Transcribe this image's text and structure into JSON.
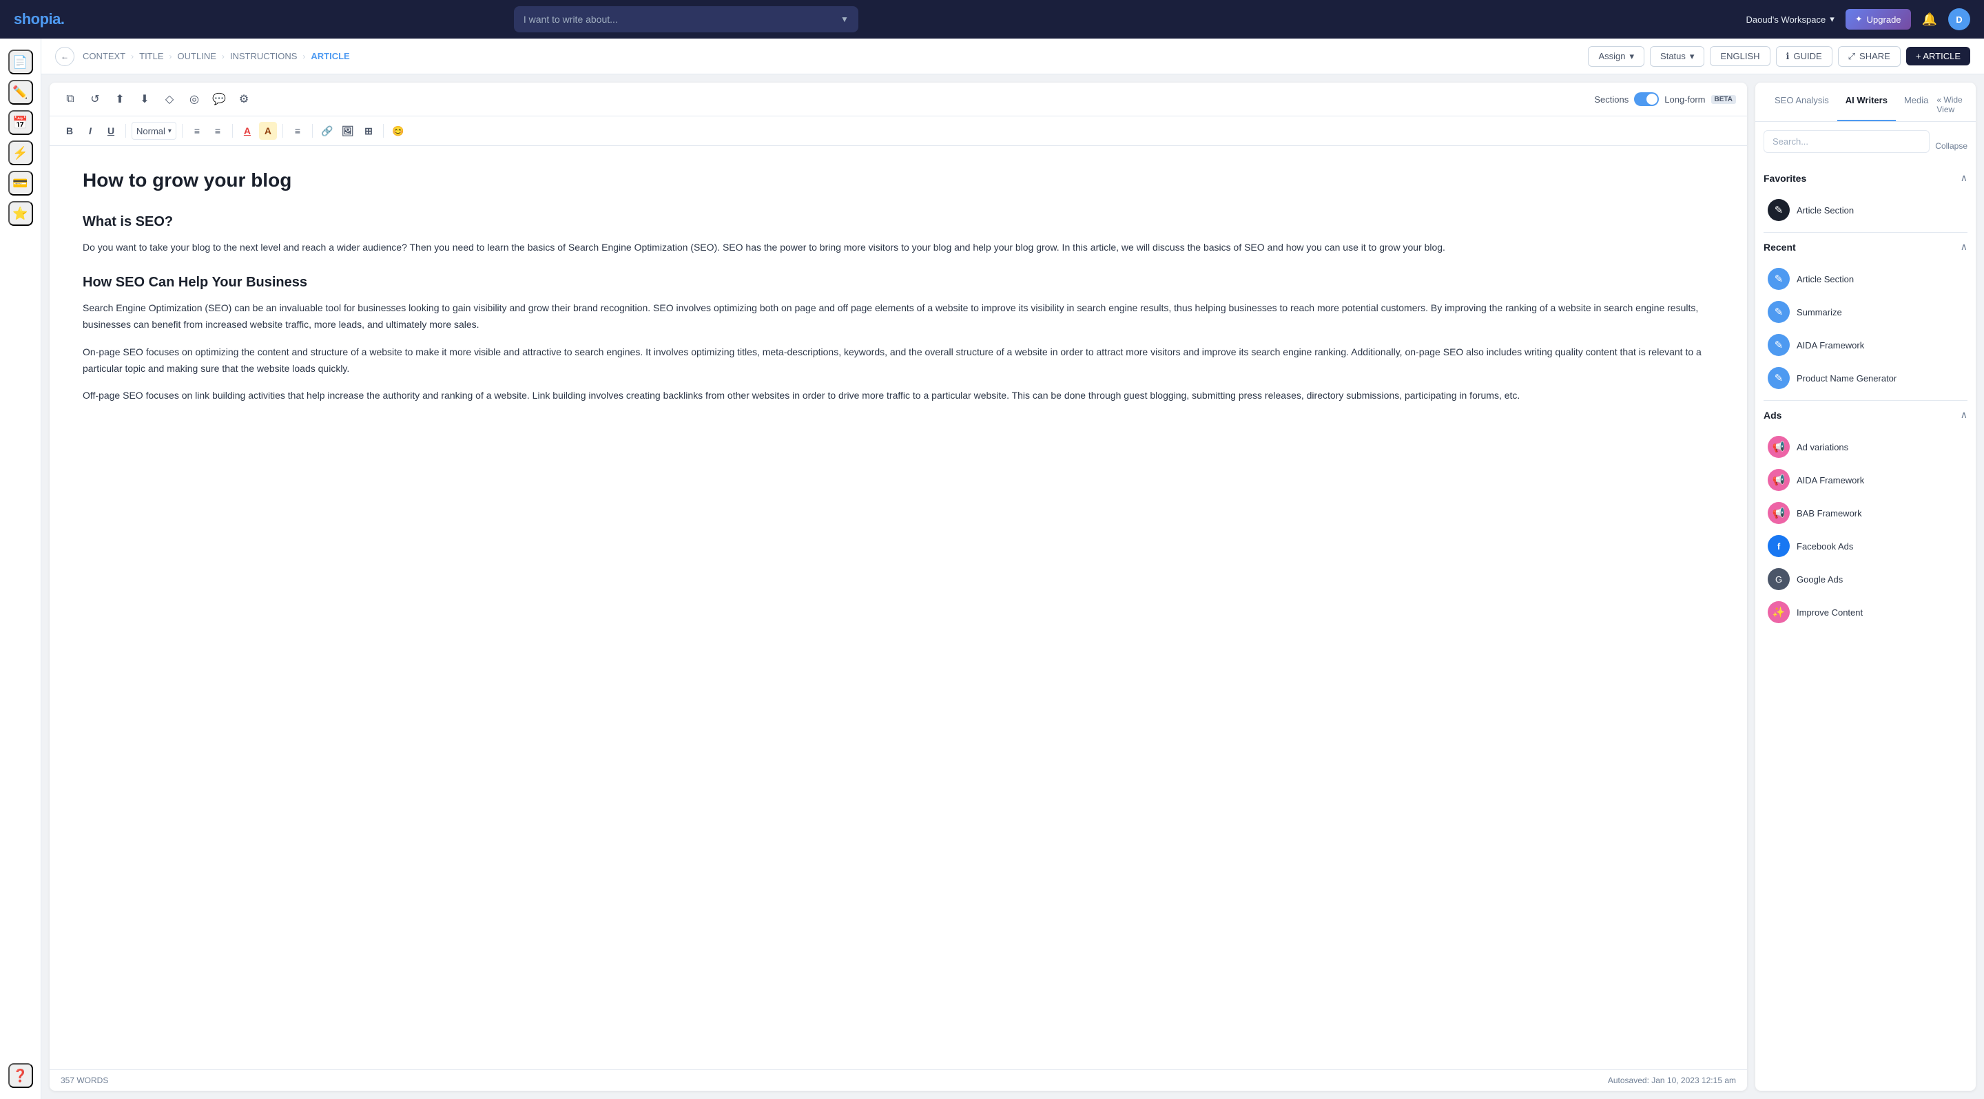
{
  "app": {
    "logo": "shopia.",
    "logo_dot_color": "#4e9af1"
  },
  "topnav": {
    "search_placeholder": "I want to write about...",
    "workspace_label": "Daoud's Workspace",
    "upgrade_label": "Upgrade",
    "avatar_initials": "D"
  },
  "breadcrumb": {
    "back_label": "←",
    "items": [
      "CONTEXT",
      "TITLE",
      "OUTLINE",
      "INSTRUCTIONS"
    ],
    "active": "ARTICLE",
    "separators": [
      ">",
      ">",
      ">",
      ">"
    ]
  },
  "breadcrumb_actions": {
    "assign_label": "Assign",
    "status_label": "Status",
    "lang_label": "ENGLISH",
    "guide_label": "GUIDE",
    "share_label": "SHARE",
    "article_label": "+ ARTICLE"
  },
  "editor_toolbar_top": {
    "icons": [
      "📋",
      "↺",
      "⬆",
      "⬇",
      "◇",
      "◎",
      "💬",
      "⚙"
    ],
    "sections_label": "Sections",
    "longform_label": "Long-form",
    "beta_label": "BETA"
  },
  "editor_format": {
    "bold": "B",
    "italic": "I",
    "underline": "U",
    "style_label": "Normal",
    "ol": "≡",
    "ul": "≡",
    "font_color": "A",
    "font_bg": "A",
    "align": "≡",
    "link": "🔗",
    "image": "🖼",
    "table": "⊞",
    "emoji": "😊"
  },
  "article": {
    "title": "How to grow your blog",
    "sections": [
      {
        "heading": "What is SEO?",
        "paragraphs": [
          "Do you want to take your blog to the next level and reach a wider audience? Then you need to learn the basics of Search Engine Optimization (SEO). SEO has the power to bring more visitors to your blog and help your blog grow. In this article, we will discuss the basics of SEO and how you can use it to grow your blog."
        ]
      },
      {
        "heading": "How SEO Can Help Your Business",
        "paragraphs": [
          "Search Engine Optimization (SEO) can be an invaluable tool for businesses looking to gain visibility and grow their brand recognition. SEO involves optimizing both on page and off page elements of a website to improve its visibility in search engine results, thus helping businesses to reach more potential customers. By improving the ranking of a website in search engine results, businesses can benefit from increased website traffic, more leads, and ultimately more sales.",
          "On-page SEO focuses on optimizing the content and structure of a website to make it more visible and attractive to search engines. It involves optimizing titles, meta-descriptions, keywords, and the overall structure of a website in order to attract more visitors and improve its search engine ranking. Additionally, on-page SEO also includes writing quality content that is relevant to a particular topic and making sure that the website loads quickly.",
          "Off-page SEO focuses on link building activities that help increase the authority and ranking of a website. Link building involves creating backlinks from other websites in order to drive more traffic to a particular website. This can be done through guest blogging, submitting press releases, directory submissions, participating in forums, etc."
        ]
      }
    ],
    "word_count": "357 WORDS",
    "autosave": "Autosaved: Jan 10, 2023 12:15 am"
  },
  "right_sidebar": {
    "tabs": [
      {
        "label": "SEO Analysis",
        "active": false
      },
      {
        "label": "AI Writers",
        "active": true
      },
      {
        "label": "Media",
        "active": false
      }
    ],
    "wide_view_label": "« Wide View",
    "search_placeholder": "Search...",
    "collapse_label": "Collapse",
    "sections": [
      {
        "title": "Favorites",
        "items": [
          {
            "label": "Article Section",
            "icon_type": "icon-black",
            "icon": "✎"
          }
        ]
      },
      {
        "title": "Recent",
        "items": [
          {
            "label": "Article Section",
            "icon_type": "icon-blue",
            "icon": "✎"
          },
          {
            "label": "Summarize",
            "icon_type": "icon-blue",
            "icon": "✎"
          },
          {
            "label": "AIDA Framework",
            "icon_type": "icon-blue",
            "icon": "✎"
          },
          {
            "label": "Product Name Generator",
            "icon_type": "icon-blue",
            "icon": "✎"
          }
        ]
      },
      {
        "title": "Ads",
        "items": [
          {
            "label": "Ad variations",
            "icon_type": "icon-pink",
            "icon": "📢"
          },
          {
            "label": "AIDA Framework",
            "icon_type": "icon-pink",
            "icon": "📢"
          },
          {
            "label": "BAB Framework",
            "icon_type": "icon-pink",
            "icon": "📢"
          },
          {
            "label": "Facebook Ads",
            "icon_type": "icon-fb",
            "icon": "f"
          },
          {
            "label": "Google Ads",
            "icon_type": "icon-google",
            "icon": "G"
          },
          {
            "label": "Improve Content",
            "icon_type": "icon-pink",
            "icon": "✨"
          }
        ]
      }
    ]
  }
}
